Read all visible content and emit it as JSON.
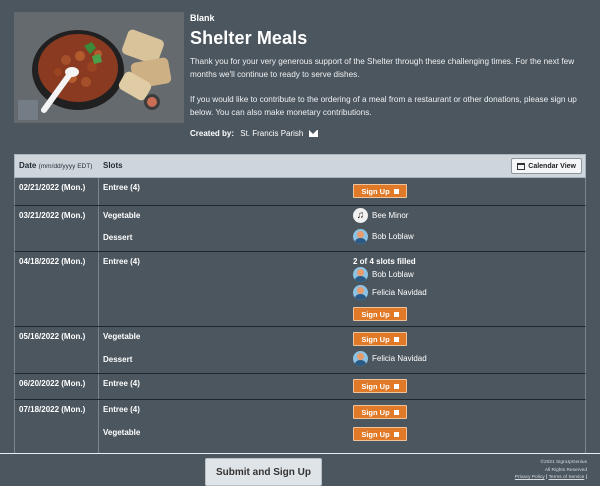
{
  "header": {
    "category": "Blank",
    "title": "Shelter Meals",
    "description_1": "Thank you for your very generous support of the Shelter through these challenging times. For the next few months we'll continue to ready to serve dishes.",
    "description_2": "If you would like to contribute to the ordering of a meal from a restaurant or other donations, please sign up below.  You can also make monetary contributions.",
    "created_by_label": "Created by:",
    "created_by_name": "St. Francis Parish",
    "mail_icon": "envelope-icon"
  },
  "table": {
    "date_header": "Date",
    "date_format": "(mm/dd/yyyy EDT)",
    "slots_header": "Slots",
    "calendar_view_label": "Calendar View",
    "signup_label": "Sign Up",
    "rows": [
      {
        "date": "02/21/2022 (Mon.)",
        "slots": [
          {
            "name": "Entree (4)",
            "signup": true
          }
        ]
      },
      {
        "date": "03/21/2022 (Mon.)",
        "slots": [
          {
            "name": "Vegetable",
            "volunteer": "Bee Minor",
            "avatar_icon": "music-note-icon"
          },
          {
            "name": "Dessert",
            "volunteer": "Bob Loblaw",
            "avatar_icon": "person-avatar"
          }
        ]
      },
      {
        "date": "04/18/2022 (Mon.)",
        "slots": [
          {
            "name": "Entree (4)",
            "status": "2 of 4 slots filled",
            "volunteers": [
              "Bob Loblaw",
              "Felicia Navidad"
            ],
            "signup": true
          }
        ]
      },
      {
        "date": "05/16/2022 (Mon.)",
        "slots": [
          {
            "name": "Vegetable",
            "signup": true
          },
          {
            "name": "Dessert",
            "volunteer": "Felicia Navidad",
            "avatar_icon": "person-avatar"
          }
        ]
      },
      {
        "date": "06/20/2022 (Mon.)",
        "slots": [
          {
            "name": "Entree (4)",
            "signup": true
          }
        ]
      },
      {
        "date": "07/18/2022 (Mon.)",
        "slots": [
          {
            "name": "Entree (4)",
            "signup": true
          },
          {
            "name": "Vegetable",
            "signup": true
          }
        ]
      }
    ]
  },
  "footer": {
    "submit_label": "Submit and Sign Up",
    "copyright": "©2021 SignUpGenius",
    "rights": "All Rights Reserved",
    "privacy": "Privacy Policy",
    "separator": "|",
    "terms": "Terms of Service",
    "terms_separator": "|"
  },
  "colors": {
    "background": "#4c565e",
    "accent_button": "#e07a28",
    "table_header": "#ced6dc"
  }
}
